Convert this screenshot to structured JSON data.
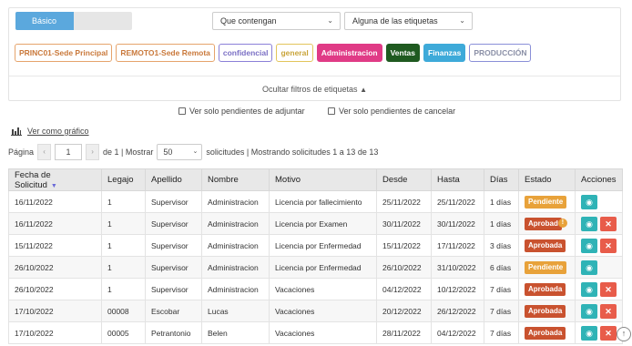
{
  "filters": {
    "mode_label": "Básico",
    "contain_select": "Que contengan",
    "labels_select": "Alguna de las etiquetas",
    "tags": [
      {
        "label": "PRINC01-Sede Principal",
        "fg": "#c9783a",
        "bg": "#ffffff",
        "border": "#e6a46c"
      },
      {
        "label": "REMOTO1-Sede Remota",
        "fg": "#c9783a",
        "bg": "#ffffff",
        "border": "#e6a46c"
      },
      {
        "label": "confidencial",
        "fg": "#7a6fc4",
        "bg": "#ffffff",
        "border": "#8b80d8"
      },
      {
        "label": "general",
        "fg": "#c9a43a",
        "bg": "#ffffff",
        "border": "#e3c55c"
      },
      {
        "label": "Administracion",
        "fg": "#ffffff",
        "bg": "#e03b86",
        "border": "#e03b86"
      },
      {
        "label": "Ventas",
        "fg": "#ffffff",
        "bg": "#1f5a20",
        "border": "#1f5a20"
      },
      {
        "label": "Finanzas",
        "fg": "#ffffff",
        "bg": "#3eaad9",
        "border": "#3eaad9"
      },
      {
        "label": "PRODUCCIÓN",
        "fg": "#8a8fa6",
        "bg": "#ffffff",
        "border": "#8a8fd8"
      }
    ],
    "hide_label": "Ocultar filtros de etiquetas"
  },
  "checks": {
    "adjuntar": "Ver solo pendientes de adjuntar",
    "cancelar": "Ver solo pendientes de cancelar"
  },
  "graph_link": "Ver como gráfico",
  "pager": {
    "page_label": "Página",
    "page_value": "1",
    "of_label": "de 1 | Mostrar",
    "per_page": "50",
    "summary": "solicitudes | Mostrando solicitudes 1 a 13 de 13"
  },
  "table": {
    "headers": [
      "Fecha de Solicitud",
      "Legajo",
      "Apellido",
      "Nombre",
      "Motivo",
      "Desde",
      "Hasta",
      "Días",
      "Estado",
      "Acciones"
    ],
    "rows": [
      {
        "c": [
          "16/11/2022",
          "1",
          "Supervisor",
          "Administracion",
          "Licencia por fallecimiento",
          "25/11/2022",
          "25/11/2022",
          "1 días"
        ],
        "estado": "Pendiente",
        "type": "pend",
        "warn": false,
        "del": false
      },
      {
        "c": [
          "16/11/2022",
          "1",
          "Supervisor",
          "Administracion",
          "Licencia por Examen",
          "30/11/2022",
          "30/11/2022",
          "1 días"
        ],
        "estado": "Aprobad",
        "type": "apr",
        "warn": true,
        "del": true
      },
      {
        "c": [
          "15/11/2022",
          "1",
          "Supervisor",
          "Administracion",
          "Licencia por Enfermedad",
          "15/11/2022",
          "17/11/2022",
          "3 días"
        ],
        "estado": "Aprobada",
        "type": "apr",
        "warn": false,
        "del": true
      },
      {
        "c": [
          "26/10/2022",
          "1",
          "Supervisor",
          "Administracion",
          "Licencia por Enfermedad",
          "26/10/2022",
          "31/10/2022",
          "6 días"
        ],
        "estado": "Pendiente",
        "type": "pend",
        "warn": false,
        "del": false
      },
      {
        "c": [
          "26/10/2022",
          "1",
          "Supervisor",
          "Administracion",
          "Vacaciones",
          "04/12/2022",
          "10/12/2022",
          "7 días"
        ],
        "estado": "Aprobada",
        "type": "apr",
        "warn": false,
        "del": true
      },
      {
        "c": [
          "17/10/2022",
          "00008",
          "Escobar",
          "Lucas",
          "Vacaciones",
          "20/12/2022",
          "26/12/2022",
          "7 días"
        ],
        "estado": "Aprobada",
        "type": "apr",
        "warn": false,
        "del": true
      },
      {
        "c": [
          "17/10/2022",
          "00005",
          "Petrantonio",
          "Belen",
          "Vacaciones",
          "28/11/2022",
          "04/12/2022",
          "7 días"
        ],
        "estado": "Aprobada",
        "type": "apr",
        "warn": false,
        "del": true
      }
    ]
  }
}
